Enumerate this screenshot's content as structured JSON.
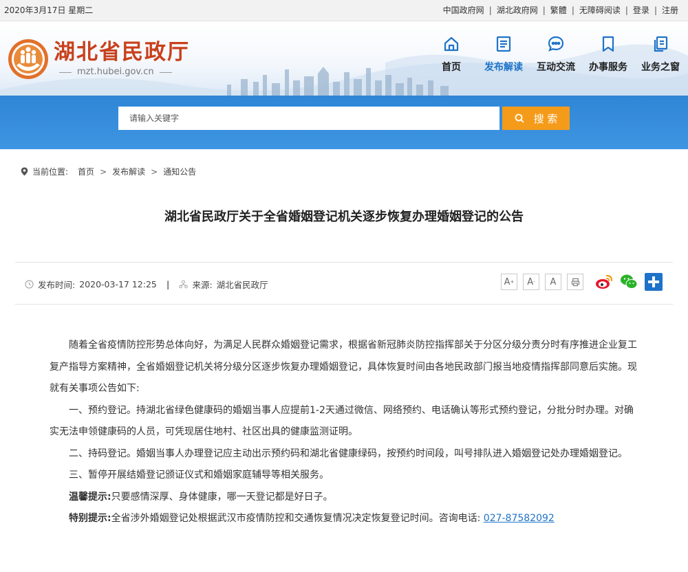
{
  "topbar": {
    "date": "2020年3月17日 星期二",
    "links": [
      "中国政府网",
      "湖北政府网",
      "繁體",
      "无障碍阅读",
      "登录",
      "注册"
    ]
  },
  "logo": {
    "title": "湖北省民政厅",
    "url": "mzt.hubei.gov.cn"
  },
  "nav": [
    {
      "label": "首页",
      "icon": "home-icon",
      "active": false
    },
    {
      "label": "发布解读",
      "icon": "document-icon",
      "active": true
    },
    {
      "label": "互动交流",
      "icon": "chat-icon",
      "active": false
    },
    {
      "label": "办事服务",
      "icon": "bookmark-icon",
      "active": false
    },
    {
      "label": "业务之窗",
      "icon": "copy-icon",
      "active": false
    }
  ],
  "search": {
    "placeholder": "请输入关键字",
    "button_label": "搜 索"
  },
  "breadcrumb": {
    "prefix": "当前位置:",
    "items": [
      "首页",
      "发布解读",
      "通知公告"
    ],
    "separator": ">"
  },
  "article": {
    "title": "湖北省民政厅关于全省婚姻登记机关逐步恢复办理婚姻登记的公告",
    "publish_label": "发布时间:",
    "publish_time": "2020-03-17 12:25",
    "source_label": "来源:",
    "source": "湖北省民政厅",
    "font_buttons": [
      "A",
      "A",
      "A"
    ],
    "paragraphs": [
      "随着全省疫情防控形势总体向好，为满足人民群众婚姻登记需求，根据省新冠肺炎防控指挥部关于分区分级分责分时有序推进企业复工复产指导方案精神，全省婚姻登记机关将分级分区逐步恢复办理婚姻登记，具体恢复时间由各地民政部门报当地疫情指挥部同意后实施。现就有关事项公告如下:",
      "一、预约登记。持湖北省绿色健康码的婚姻当事人应提前1-2天通过微信、网络预约、电话确认等形式预约登记，分批分时办理。对确实无法申领健康码的人员，可凭现居住地村、社区出具的健康监测证明。",
      "二、持码登记。婚姻当事人办理登记应主动出示预约码和湖北省健康绿码，按预约时间段，叫号排队进入婚姻登记处办理婚姻登记。",
      "三、暂停开展结婚登记颁证仪式和婚姻家庭辅导等相关服务。"
    ],
    "tip1_label": "温馨提示:",
    "tip1_text": "只要感情深厚、身体健康，哪一天登记都是好日子。",
    "tip2_label": "特别提示:",
    "tip2_text": "全省涉外婚姻登记处根据武汉市疫情防控和交通恢复情况决定恢复登记时间。咨询电话:",
    "phone": "027-87582092"
  },
  "colors": {
    "brand_red": "#c8401c",
    "nav_blue": "#1e73c8",
    "search_band": "#3a90df",
    "search_button": "#f59b1a"
  }
}
